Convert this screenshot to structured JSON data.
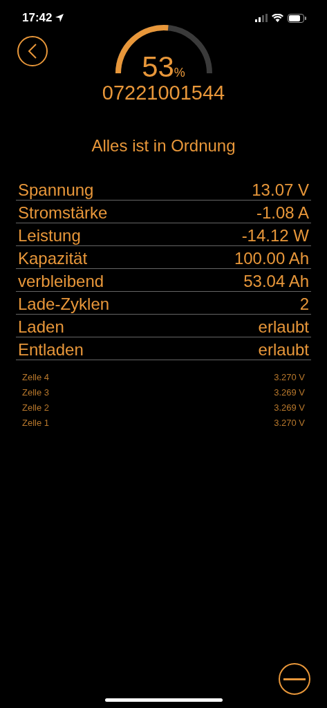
{
  "status_bar": {
    "time": "17:42"
  },
  "gauge": {
    "percent": "53",
    "unit": "%"
  },
  "serial": "07221001544",
  "status_message": "Alles ist in Ordnung",
  "readings": [
    {
      "label": "Spannung",
      "value": "13.07 V"
    },
    {
      "label": "Stromstärke",
      "value": "-1.08 A"
    },
    {
      "label": "Leistung",
      "value": "-14.12 W"
    },
    {
      "label": "Kapazität",
      "value": "100.00 Ah"
    },
    {
      "label": "verbleibend",
      "value": "53.04 Ah"
    },
    {
      "label": "Lade-Zyklen",
      "value": "2"
    },
    {
      "label": "Laden",
      "value": "erlaubt"
    },
    {
      "label": "Entladen",
      "value": "erlaubt"
    }
  ],
  "cells": [
    {
      "label": "Zelle 4",
      "value": "3.270 V"
    },
    {
      "label": "Zelle 3",
      "value": "3.269 V"
    },
    {
      "label": "Zelle 2",
      "value": "3.269 V"
    },
    {
      "label": "Zelle 1",
      "value": "3.270 V"
    }
  ]
}
